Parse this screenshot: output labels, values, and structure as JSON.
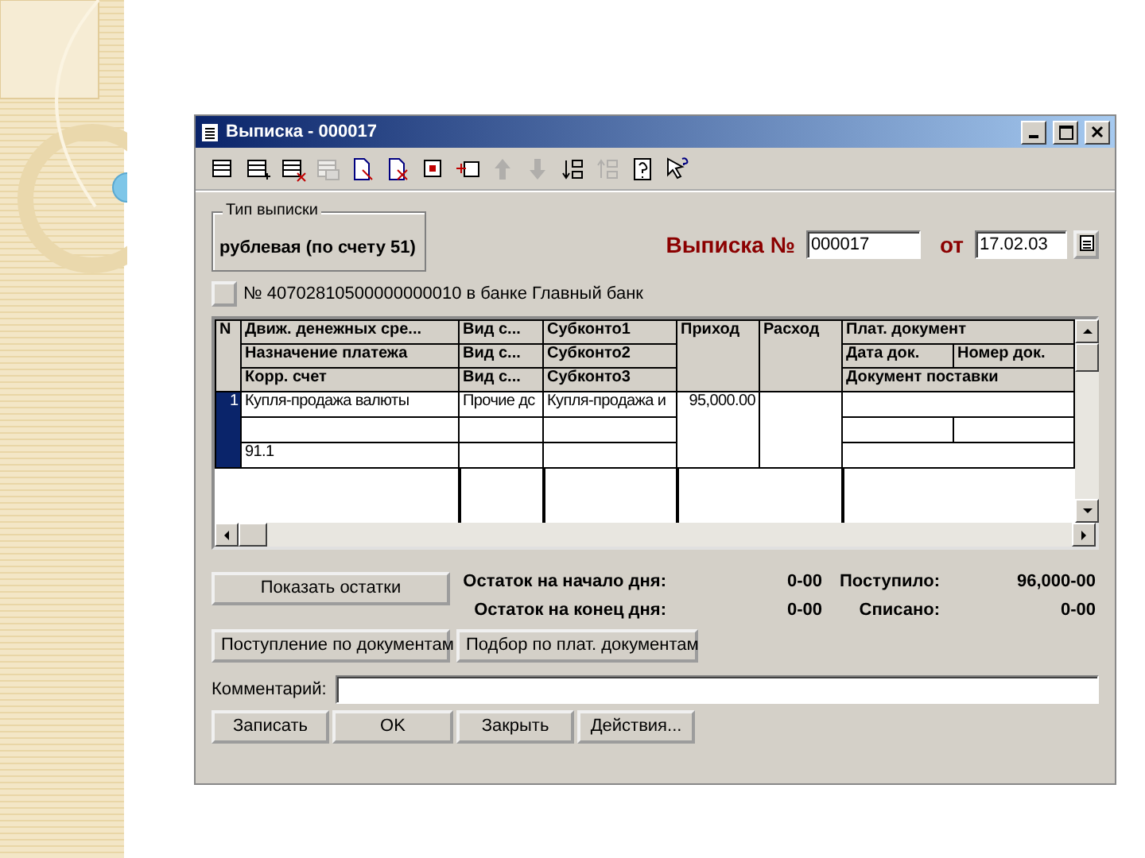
{
  "window": {
    "title": "Выписка - 000017"
  },
  "toolbar": [
    {
      "kind": "grid",
      "disabled": false
    },
    {
      "kind": "grid-add",
      "disabled": false
    },
    {
      "kind": "grid-delete",
      "disabled": false
    },
    {
      "kind": "grid-copy",
      "disabled": true
    },
    {
      "kind": "doc",
      "disabled": false
    },
    {
      "kind": "doc-delete",
      "disabled": false
    },
    {
      "kind": "box-edit",
      "disabled": false
    },
    {
      "kind": "box-add",
      "disabled": false
    },
    {
      "kind": "up",
      "disabled": true
    },
    {
      "kind": "down",
      "disabled": true
    },
    {
      "kind": "sort-asc",
      "disabled": false
    },
    {
      "kind": "sort-desc",
      "disabled": true
    },
    {
      "kind": "help",
      "disabled": false
    },
    {
      "kind": "help-pointer",
      "disabled": false
    }
  ],
  "statement_type": {
    "legend": "Тип выписки",
    "value": "рублевая (по счету 51)"
  },
  "number": {
    "label": "Выписка №",
    "value": "000017"
  },
  "date": {
    "label": "от",
    "value": "17.02.03"
  },
  "account": {
    "text": "№ 40702810500000000010 в банке Главный банк"
  },
  "table": {
    "header": {
      "n": "N",
      "col1": [
        "Движ. денежных сре...",
        "Назначение платежа",
        "Корр. счет"
      ],
      "col2": [
        "Вид с...",
        "Вид с...",
        "Вид с..."
      ],
      "col3": [
        "Субконто1",
        "Субконто2",
        "Субконто3"
      ],
      "income": "Приход",
      "expense": "Расход",
      "doc": "Плат. документ",
      "doc_date": "Дата док.",
      "doc_number": "Номер док.",
      "supply": "Документ поставки"
    },
    "rows": [
      {
        "n": "1",
        "selected": true,
        "movement": "Купля-продажа валюты",
        "corr_account": "91.1",
        "kind1": "Прочие дс",
        "subconto1": "Купля-продажа и",
        "income": "95,000.00"
      }
    ]
  },
  "balances": {
    "button": "Показать остатки",
    "start_label": "Остаток на начало дня:",
    "start_value": "0-00",
    "end_label": "Остаток на конец дня:",
    "end_value": "0-00",
    "in_label": "Поступило:",
    "in_value": "96,000-00",
    "out_label": "Списано:",
    "out_value": "0-00"
  },
  "doc_buttons": [
    "Поступление по документам",
    "Подбор по плат. документам"
  ],
  "comment": {
    "label": "Комментарий:"
  },
  "buttons": [
    "Записать",
    "OK",
    "Закрыть",
    "Действия..."
  ]
}
